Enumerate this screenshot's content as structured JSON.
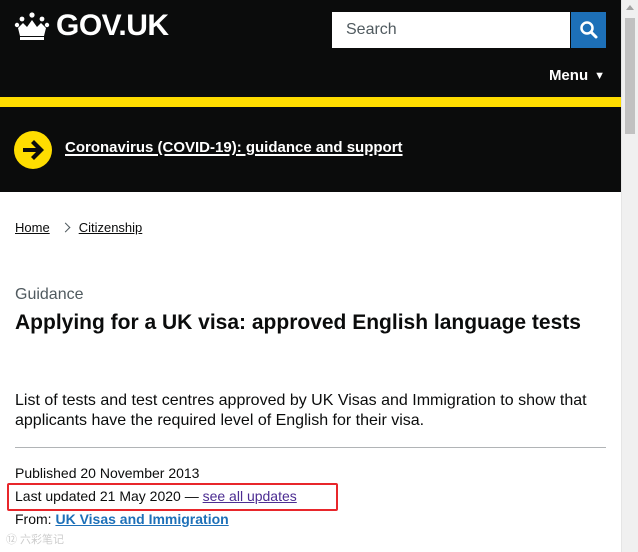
{
  "header": {
    "logo_text": "GOV.UK",
    "search": {
      "placeholder": "Search"
    },
    "menu_label": "Menu",
    "menu_caret": "▼"
  },
  "banner": {
    "link_text": "Coronavirus (COVID-19): guidance and support"
  },
  "breadcrumb": {
    "items": [
      {
        "label": "Home"
      },
      {
        "label": "Citizenship"
      }
    ]
  },
  "page": {
    "caption": "Guidance",
    "title": "Applying for a UK visa: approved English language tests",
    "lead": "List of tests and test centres approved by UK Visas and Immigration to show that applicants have the required level of English for their visa."
  },
  "metadata": {
    "published_prefix": "Published ",
    "published_date": "20 November 2013",
    "updated_prefix": "Last updated ",
    "updated_date": "21 May 2020",
    "updated_sep": " — ",
    "see_updates_link": "see all updates",
    "from_label": "From: ",
    "from_org": "UK Visas and Immigration"
  },
  "colors": {
    "header_bg": "#0b0c0c",
    "yellow": "#ffdd00",
    "link_blue": "#1d70b8",
    "visited_purple": "#4c2c92",
    "highlight_red": "#e8262b"
  },
  "watermark": "⑫ 六彩笔记"
}
